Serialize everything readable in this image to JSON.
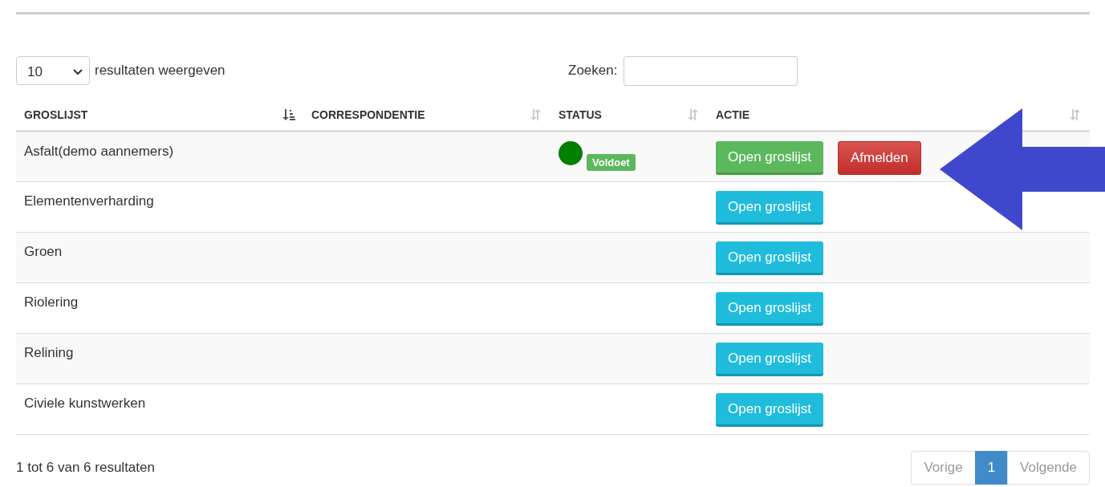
{
  "length_select": {
    "value": "10",
    "label": "resultaten weergeven"
  },
  "search": {
    "label": "Zoeken:"
  },
  "table": {
    "columns": [
      {
        "label": "GROSLIJST",
        "sorted": true
      },
      {
        "label": "CORRESPONDENTIE",
        "sorted": false
      },
      {
        "label": "STATUS",
        "sorted": false
      },
      {
        "label": "ACTIE",
        "sorted": false
      }
    ],
    "rows": [
      {
        "name": "Asfalt(demo aannemers)",
        "status": {
          "color": "#008000",
          "label": "Voldoet"
        },
        "actions": [
          {
            "label": "Open groslijst",
            "kind": "success"
          },
          {
            "label": "Afmelden",
            "kind": "danger"
          }
        ]
      },
      {
        "name": "Elementenverharding",
        "actions": [
          {
            "label": "Open groslijst",
            "kind": "info"
          }
        ]
      },
      {
        "name": "Groen",
        "actions": [
          {
            "label": "Open groslijst",
            "kind": "info"
          }
        ]
      },
      {
        "name": "Riolering",
        "actions": [
          {
            "label": "Open groslijst",
            "kind": "info"
          }
        ]
      },
      {
        "name": "Relining",
        "actions": [
          {
            "label": "Open groslijst",
            "kind": "info"
          }
        ]
      },
      {
        "name": "Civiele kunstwerken",
        "actions": [
          {
            "label": "Open groslijst",
            "kind": "info"
          }
        ]
      }
    ]
  },
  "info": "1 tot 6 van 6 resultaten",
  "pagination": [
    {
      "label": "Vorige",
      "selected": false
    },
    {
      "label": "1",
      "selected": true
    },
    {
      "label": "Volgende",
      "selected": false
    }
  ]
}
